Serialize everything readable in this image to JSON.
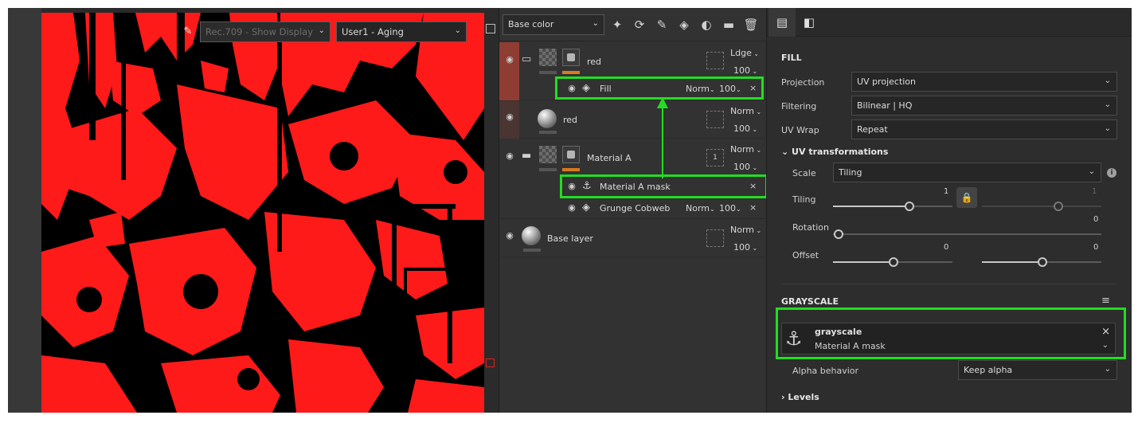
{
  "viewport": {
    "colorspace_select": "Rec.709 - Show Display",
    "view_select": "User1 - Aging"
  },
  "layers": {
    "channel_select": "Base color",
    "rows": [
      {
        "name": "red",
        "blend": "Ldge",
        "opacity": "100"
      },
      {
        "name": "red",
        "blend": "Norm",
        "opacity": "100"
      },
      {
        "name": "Material A",
        "blend": "Norm",
        "opacity": "100"
      },
      {
        "name": "Base layer",
        "blend": "Norm",
        "opacity": "100"
      }
    ],
    "sub_fill": {
      "name": "Fill",
      "blend": "Norm",
      "opacity": "100"
    },
    "sub_mask": {
      "name": "Material A mask"
    },
    "sub_grunge": {
      "name": "Grunge Cobweb",
      "blend": "Norm",
      "opacity": "100"
    },
    "mask_count": "1"
  },
  "properties": {
    "fill_title": "FILL",
    "projection_label": "Projection",
    "projection_value": "UV projection",
    "filtering_label": "Filtering",
    "filtering_value": "Bilinear | HQ",
    "uvwrap_label": "UV Wrap",
    "uvwrap_value": "Repeat",
    "uvt_title": "UV transformations",
    "scale_label": "Scale",
    "scale_value": "Tiling",
    "tiling_label": "Tiling",
    "tiling_value": "1",
    "tiling_value2": "1",
    "rotation_label": "Rotation",
    "rotation_value": "0",
    "offset_label": "Offset",
    "offset_x": "0",
    "offset_y": "0",
    "grayscale_title": "GRAYSCALE",
    "grayscale_name": "grayscale",
    "grayscale_source": "Material A mask",
    "alpha_label": "Alpha behavior",
    "alpha_value": "Keep alpha",
    "levels_title": "Levels"
  },
  "colors": {
    "highlight": "#22dd22",
    "selected_layer": "#8f3d32",
    "mask_red": "#ff1a1a",
    "accent_orange": "#d87a20"
  }
}
